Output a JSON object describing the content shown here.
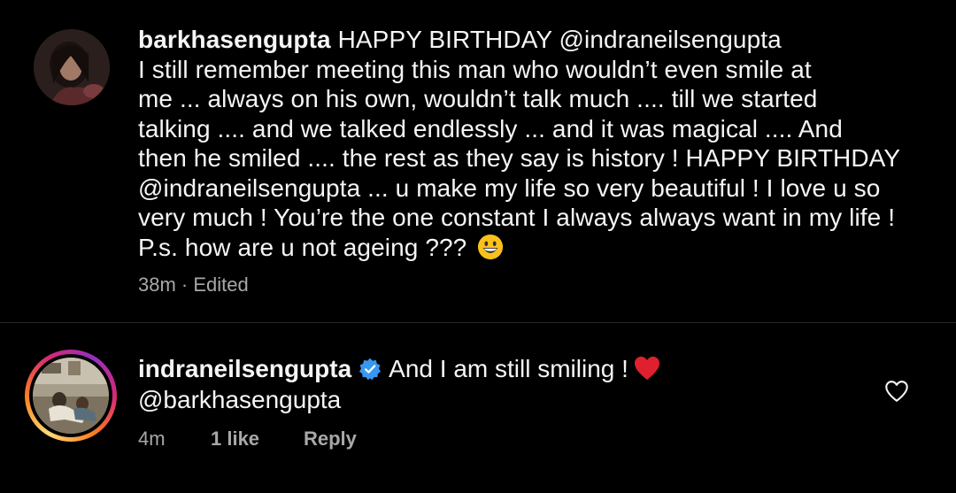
{
  "caption": {
    "username": "barkhasengupta",
    "lines": [
      "HAPPY BIRTHDAY @indraneilsengupta",
      "I still remember meeting this man who wouldn’t even smile at",
      "me ... always on his own, wouldn’t talk much .... till we started",
      "talking .... and we talked endlessly ... and it was magical .... And",
      "then he smiled .... the rest as they say is history ! HAPPY BIRTHDAY",
      "@indraneilsengupta ... u make my life so very beautiful ! I love u so",
      "very much !  You’re the one constant I always always want in my life !",
      "P.s. how are u not ageing ???"
    ],
    "emoji": "grinning-face-emoji",
    "time": "38m",
    "separator": "·",
    "edited": "Edited"
  },
  "reply": {
    "username": "indraneilsengupta",
    "verified_icon": "verified-badge-icon",
    "text": "And I am still smiling !",
    "emoji": "red-heart-emoji",
    "mention": "@barkhasengupta",
    "time": "4m",
    "likes": "1 like",
    "reply_label": "Reply",
    "like_icon": "heart-outline-icon"
  },
  "colors": {
    "background": "#000000",
    "text": "#f5f5f5",
    "secondary_text": "#a8a8a8",
    "verified_blue": "#3897f0",
    "heart_red": "#e0202e"
  }
}
